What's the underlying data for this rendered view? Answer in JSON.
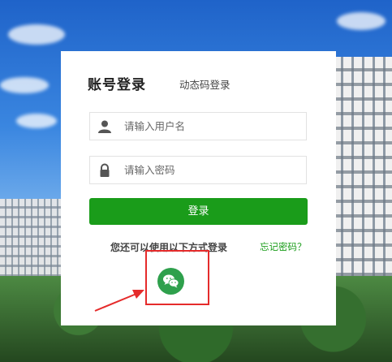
{
  "tabs": {
    "account_login": "账号登录",
    "dynamic_code_login": "动态码登录"
  },
  "form": {
    "username_placeholder": "请输入用户名",
    "password_placeholder": "请输入密码",
    "login_button": "登录"
  },
  "alt_login": {
    "text": "您还可以使用以下方式登录",
    "forgot_password": "忘记密码？",
    "wechat_icon": "wechat-icon"
  },
  "colors": {
    "primary_green": "#1a9c1a",
    "highlight_red": "#e52b2b"
  }
}
